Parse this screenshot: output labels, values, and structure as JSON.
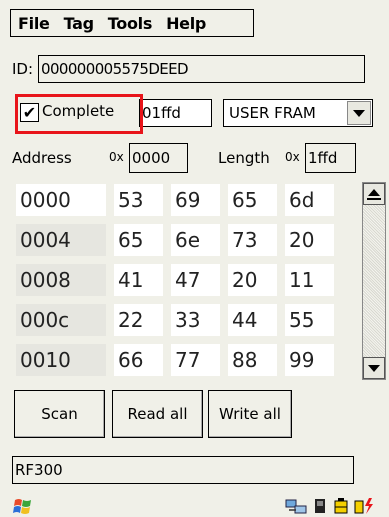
{
  "menu": {
    "file": "File",
    "tag": "Tag",
    "tools": "Tools",
    "help": "Help"
  },
  "id_row": {
    "label": "ID:",
    "value": "000000005575DEED"
  },
  "options": {
    "complete_label": "Complete",
    "complete_checked": true,
    "check_mark": "✔",
    "length_value": "01ffd",
    "memory_select": "USER FRAM"
  },
  "range": {
    "address_label": "Address",
    "address_prefix": "0x",
    "address_value": "0000",
    "length_label": "Length",
    "length_prefix": "0x",
    "length_value": "1ffd"
  },
  "grid": {
    "rows": [
      {
        "addr": "0000",
        "v": [
          "53",
          "69",
          "65",
          "6d"
        ]
      },
      {
        "addr": "0004",
        "v": [
          "65",
          "6e",
          "73",
          "20"
        ]
      },
      {
        "addr": "0008",
        "v": [
          "41",
          "47",
          "20",
          "11"
        ]
      },
      {
        "addr": "000c",
        "v": [
          "22",
          "33",
          "44",
          "55"
        ]
      },
      {
        "addr": "0010",
        "v": [
          "66",
          "77",
          "88",
          "99"
        ]
      }
    ]
  },
  "buttons": {
    "scan": "Scan",
    "read_all": "Read all",
    "write_all": "Write all"
  },
  "status": {
    "text": "RF300"
  },
  "colors": {
    "highlight": "#e8141a",
    "background": "#f0f0e8"
  },
  "taskbar_icons": [
    "windows-flag-icon",
    "network-icon",
    "device-icon",
    "battery-icon",
    "power-icon"
  ]
}
